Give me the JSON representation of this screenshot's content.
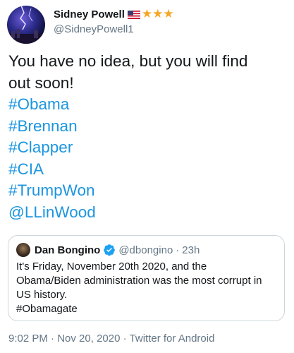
{
  "author": {
    "display_name": "Sidney Powell",
    "handle": "@SidneyPowell1",
    "flag_icon": "us-flag-icon",
    "stars": "★★★",
    "star_color": "#f5a623"
  },
  "tweet": {
    "lines": [
      "You have no idea, but you will find",
      "out soon!"
    ],
    "tags": [
      "#Obama",
      "#Brennan",
      "#Clapper",
      "#CIA",
      "#TrumpWon",
      "@LLinWood"
    ],
    "link_color": "#1b95e0"
  },
  "quote": {
    "display_name": "Dan Bongino",
    "handle": "@dbongino",
    "separator": "·",
    "time": "23h",
    "verified_icon": "verified-badge-icon",
    "lines": [
      "It's Friday, November 20th 2020, and the",
      "Obama/Biden administration was the most corrupt in",
      "US history.",
      "#Obamagate"
    ]
  },
  "meta": {
    "time": "9:02 PM",
    "separator": "·",
    "date": "Nov 20, 2020",
    "source": "Twitter for Android"
  }
}
